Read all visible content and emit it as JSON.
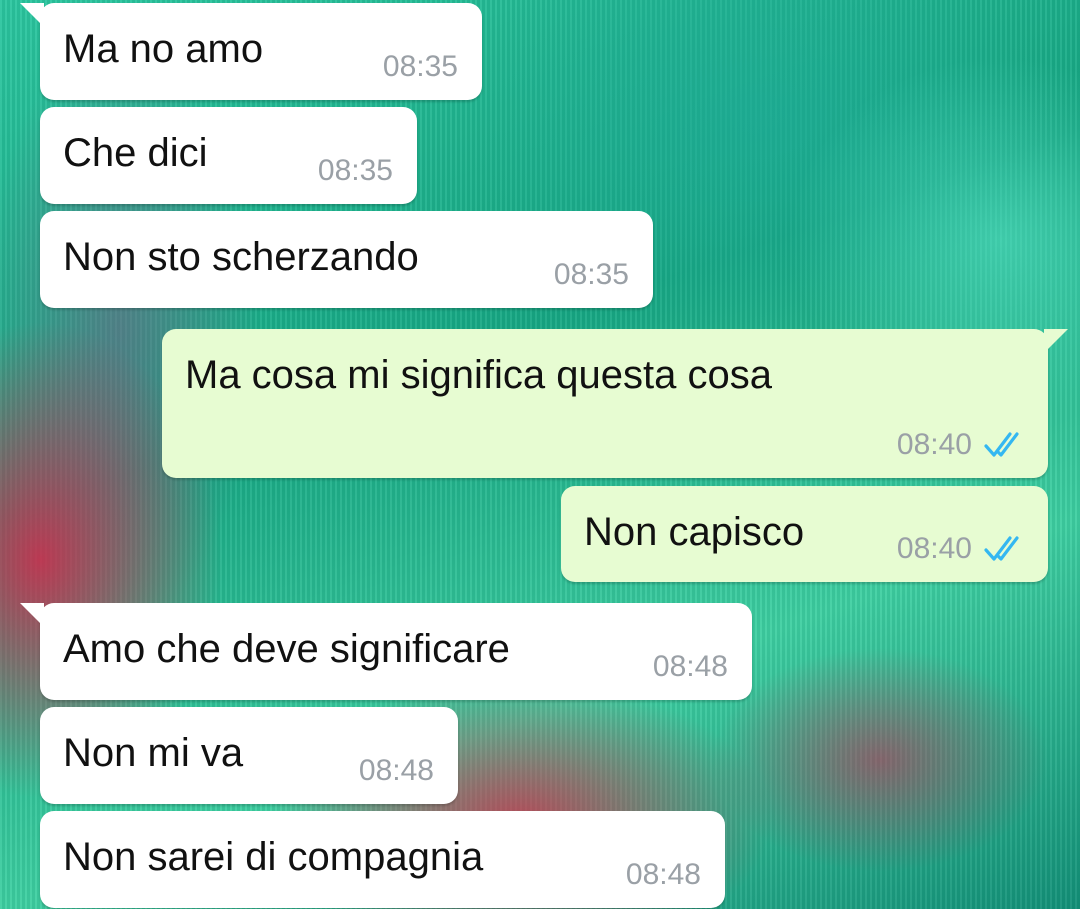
{
  "messages": [
    {
      "direction": "incoming",
      "text": "Ma no amo",
      "time": "08:35"
    },
    {
      "direction": "incoming",
      "text": "Che dici",
      "time": "08:35"
    },
    {
      "direction": "incoming",
      "text": "Non sto scherzando",
      "time": "08:35"
    },
    {
      "direction": "outgoing",
      "text": "Ma cosa mi significa questa cosa",
      "time": "08:40",
      "status_icon": "double-check-read-icon"
    },
    {
      "direction": "outgoing",
      "text": "Non capisco",
      "time": "08:40",
      "status_icon": "double-check-read-icon"
    },
    {
      "direction": "incoming",
      "text": "Amo che deve significare",
      "time": "08:48"
    },
    {
      "direction": "incoming",
      "text": "Non mi va",
      "time": "08:48"
    },
    {
      "direction": "incoming",
      "text": "Non sarei di compagnia",
      "time": "08:48"
    }
  ],
  "colors": {
    "incoming_bubble": "#ffffff",
    "outgoing_bubble": "#e7fcd2",
    "read_tick": "#34b7f1",
    "timestamp": "#9aa0a6"
  }
}
